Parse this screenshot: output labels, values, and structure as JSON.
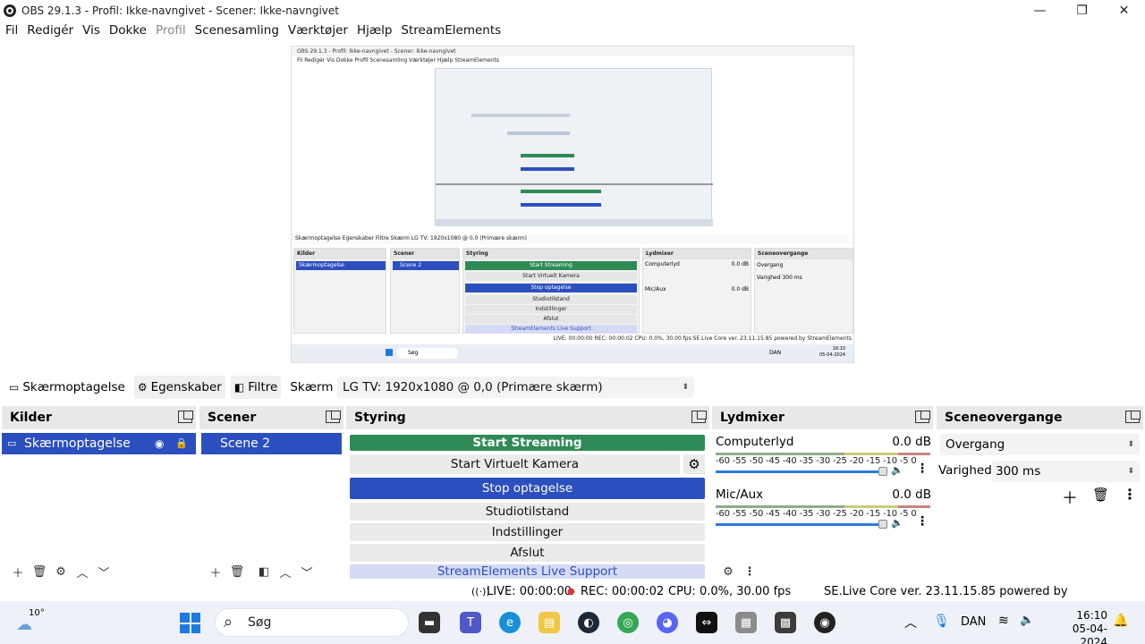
{
  "window": {
    "title": "OBS 29.1.3 - Profil: Ikke-navngivet - Scener: Ikke-navngivet",
    "minimize": "—",
    "maximize": "❐",
    "close": "✕"
  },
  "menu": [
    "Fil",
    "Redigér",
    "Vis",
    "Dokke",
    "Profil",
    "Scenesamling",
    "Værktøjer",
    "Hjælp",
    "StreamElements"
  ],
  "preview_mini": {
    "title": "OBS 29.1.3 - Profil: Ikke-navngivet - Scener: Ikke-navngivet",
    "menu": "Fil  Redigér  Vis  Dokke  Profil  Scenesamling  Værktøjer  Hjælp  StreamElements",
    "source_toolbar": "Skærmoptagelse   Egenskaber   Filtre   Skærm   LG TV: 1920x1080 @ 0,0 (Primære skærm)",
    "kilder": "Kilder",
    "kilder_item": "Skærmoptagelse",
    "scener": "Scener",
    "scener_item": "Scene 2",
    "styring": "Styring",
    "buttons": [
      "Start Streaming",
      "Start Virtuelt Kamera",
      "Stop optagelse",
      "Studiotilstand",
      "Indstillinger",
      "Afslut",
      "StreamElements Live Support"
    ],
    "lydmixer": "Lydmixer",
    "computerlyd": "Computerlyd",
    "micaux": "Mic/Aux",
    "db": "0.0 dB",
    "sceneovergange": "Sceneovergange",
    "overgang": "Overgang",
    "varighed": "Varighed  300 ms",
    "status": "LIVE: 00:00:00   REC: 00:00:02   CPU: 0.0%, 30.00 fps   SE.Live Core ver. 23.11.15.85 powered by StreamElements",
    "search": "Søg",
    "lang": "DAN",
    "time": "16:10",
    "date": "05-04-2024"
  },
  "source_toolbar": {
    "source_name": "Skærmoptagelse",
    "properties": "Egenskaber",
    "filters": "Filtre",
    "screen_label": "Skærm",
    "screen_value": "LG TV: 1920x1080 @ 0,0 (Primære skærm)"
  },
  "docks": {
    "sources": {
      "title": "Kilder",
      "items": [
        "Skærmoptagelse"
      ]
    },
    "scenes": {
      "title": "Scener",
      "items": [
        "Scene 2"
      ]
    },
    "controls": {
      "title": "Styring",
      "start_streaming": "Start Streaming",
      "start_virtual_camera": "Start Virtuelt Kamera",
      "stop_recording": "Stop optagelse",
      "studio_mode": "Studiotilstand",
      "settings": "Indstillinger",
      "exit": "Afslut",
      "live_support": "StreamElements Live Support"
    },
    "mixer": {
      "title": "Lydmixer",
      "scale": "-60 -55 -50 -45 -40 -35 -30 -25 -20 -15 -10  -5   0",
      "tracks": [
        {
          "name": "Computerlyd",
          "db": "0.0 dB"
        },
        {
          "name": "Mic/Aux",
          "db": "0.0 dB"
        }
      ]
    },
    "transitions": {
      "title": "Sceneovergange",
      "transition": "Overgang",
      "duration_label": "Varighed",
      "duration_value": "300 ms"
    }
  },
  "status": {
    "live": "LIVE: 00:00:00",
    "rec": "REC: 00:00:02",
    "cpu": "CPU: 0.0%, 30.00 fps",
    "core": "SE.Live Core ver. 23.11.15.85 powered by StreamElements"
  },
  "taskbar": {
    "weather": "10°",
    "search_placeholder": "Søg",
    "language": "DAN",
    "time": "16:10",
    "date": "05-04-2024"
  },
  "colors": {
    "stream_green": "#2e8b57",
    "record_blue": "#2c4fc0",
    "support_lavender": "#d6daf5"
  }
}
